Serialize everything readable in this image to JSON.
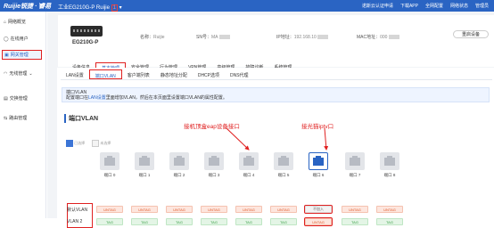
{
  "topbar": {
    "logo": "Ruijie锐捷 · 睿易",
    "device_title": "工业EG210G-P",
    "device_name": "Ruijie",
    "device_badge": "1",
    "actions": [
      "诺斯云认证申请",
      "下载APP",
      "全网配置",
      "网络状态",
      "管理员"
    ]
  },
  "sidebar": {
    "items": [
      {
        "label": "网络概览",
        "icon": "home-icon",
        "active": false
      },
      {
        "label": "在线用户",
        "icon": "user-icon",
        "active": false
      },
      {
        "label": "网关管理",
        "icon": "router-icon",
        "active": true
      },
      {
        "label": "无线管理",
        "icon": "wifi-icon",
        "active": false
      },
      {
        "label": "交换管理",
        "icon": "switch-icon",
        "active": false
      },
      {
        "label": "路由管理",
        "icon": "route-icon",
        "active": false
      }
    ]
  },
  "device": {
    "name": "EG210G-P",
    "alias_label": "名称：",
    "alias_value": "Ruijie",
    "sn_label": "SN号：",
    "sn_value": "MA",
    "ip_label": "IP地址：",
    "ip_value": "192.168.10",
    "mac_label": "MAC地址：",
    "mac_value": "000",
    "reset_label": "重启设备"
  },
  "tabs1": [
    "设备信息",
    "基本管理",
    "安全管理",
    "行为管理",
    "VPN管理",
    "高级管理",
    "故障诊断",
    "系统管理"
  ],
  "tabs1_active": 1,
  "tabs2": [
    "LAN设置",
    "端口VLAN",
    "客户端列表",
    "静态地址分配",
    "DHCP选项",
    "DNS代理"
  ],
  "tabs2_active": 1,
  "notice": {
    "title": "端口VLAN",
    "text_pre": "配置端口在",
    "link": "LAN设置",
    "text_post": "里面增加VLAN，然后在本页面里设置端口VLAN的属性配置。"
  },
  "section_title": "端口VLAN",
  "annotations": {
    "ap_port": "接机顶盒eap设备接口",
    "iptv_port": "接光猫iptv口"
  },
  "legend": {
    "selected": "已选择",
    "unselected": "未选择"
  },
  "ports": [
    "端口 0",
    "端口 1",
    "端口 2",
    "端口 3",
    "端口 4",
    "端口 5",
    "端口 6",
    "端口 7",
    "端口 8"
  ],
  "selected_port": 6,
  "vlan_rows": [
    {
      "label": "默认VLAN",
      "cells": [
        "UNTAG",
        "UNTAG",
        "UNTAG",
        "UNTAG",
        "UNTAG",
        "UNTAG",
        "不加入",
        "UNTAG",
        "UNTAG"
      ]
    },
    {
      "label": "VLAN 2",
      "cells": [
        "TAG",
        "TAG",
        "TAG",
        "TAG",
        "TAG",
        "TAG",
        "UNTAG",
        "TAG",
        "TAG"
      ]
    }
  ],
  "colors": {
    "primary": "#2a64c3",
    "highlight": "#e02020",
    "untag": "#e05a2b",
    "tag": "#3aa048"
  }
}
